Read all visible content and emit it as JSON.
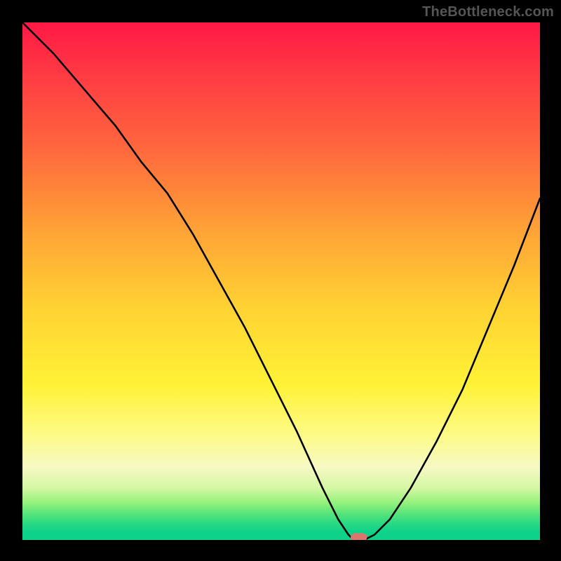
{
  "watermark": "TheBottleneck.com",
  "chart_data": {
    "type": "line",
    "title": "",
    "xlabel": "",
    "ylabel": "",
    "xlim": [
      0,
      100
    ],
    "ylim": [
      0,
      100
    ],
    "series": [
      {
        "name": "curve",
        "x": [
          0,
          6,
          12,
          18,
          23,
          28,
          33,
          38,
          43,
          48,
          53,
          58,
          61,
          63,
          64,
          66,
          68,
          71,
          75,
          80,
          85,
          90,
          95,
          100
        ],
        "y": [
          100,
          94,
          87,
          80,
          73,
          67,
          59,
          50,
          41,
          31,
          21,
          10,
          4,
          1,
          0,
          0,
          1,
          4,
          10,
          19,
          29,
          41,
          53,
          66
        ]
      }
    ],
    "marker": {
      "x": 65,
      "y": 0.5,
      "color": "#d9776f"
    },
    "gradient_stops": [
      {
        "pct": 0,
        "color": "#ff1845"
      },
      {
        "pct": 10,
        "color": "#ff3a44"
      },
      {
        "pct": 25,
        "color": "#ff6a3d"
      },
      {
        "pct": 40,
        "color": "#ffa236"
      },
      {
        "pct": 55,
        "color": "#ffd233"
      },
      {
        "pct": 70,
        "color": "#fff236"
      },
      {
        "pct": 80,
        "color": "#fdfb8a"
      },
      {
        "pct": 86,
        "color": "#f6f9c4"
      },
      {
        "pct": 90,
        "color": "#d4f7a3"
      },
      {
        "pct": 93,
        "color": "#8ff07a"
      },
      {
        "pct": 95,
        "color": "#55e37b"
      },
      {
        "pct": 97,
        "color": "#25d884"
      },
      {
        "pct": 98.5,
        "color": "#0ed28a"
      },
      {
        "pct": 100,
        "color": "#0ed28a"
      }
    ]
  }
}
